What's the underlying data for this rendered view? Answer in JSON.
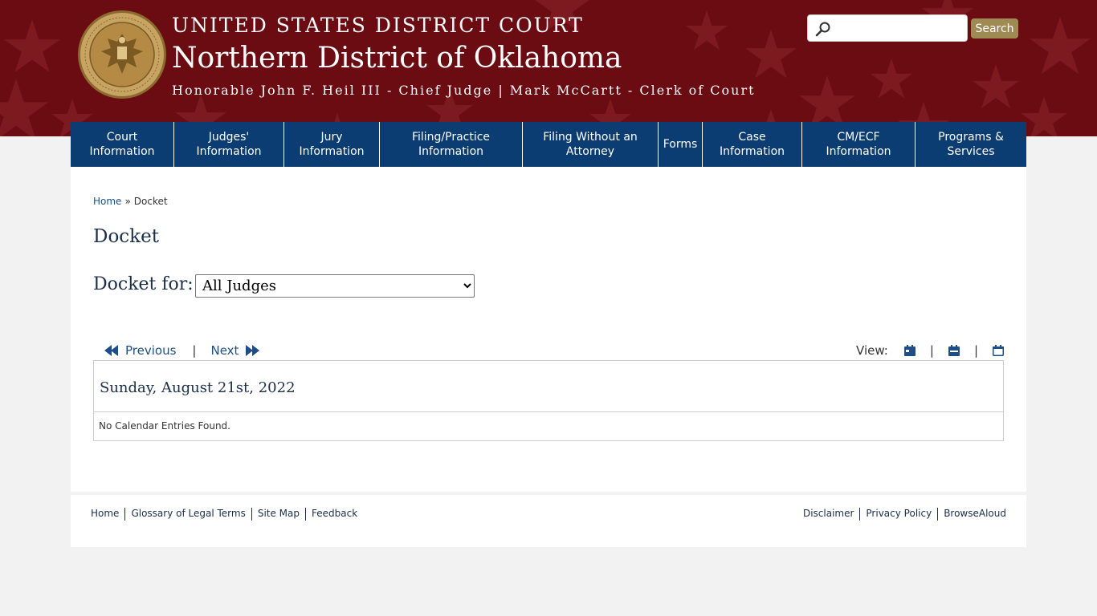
{
  "header": {
    "court_line": "UNITED STATES DISTRICT COURT",
    "district": "Northern District of Oklahoma",
    "officials": "Honorable John F. Heil III - Chief Judge | Mark McCartt - Clerk of Court",
    "seal_icon": "court-seal-icon",
    "search": {
      "placeholder": "",
      "button_label": "Search",
      "icon": "search-icon"
    },
    "colors": {
      "background": "#6b0b12",
      "search_button": "#a08a54"
    }
  },
  "nav": {
    "color": "#0b3d73",
    "items": [
      {
        "line1": "Court",
        "line2": "Information"
      },
      {
        "line1": "Judges'",
        "line2": "Information"
      },
      {
        "line1": "Jury",
        "line2": "Information"
      },
      {
        "line1": "Filing/Practice",
        "line2": "Information"
      },
      {
        "line1": "Filing Without an",
        "line2": "Attorney"
      },
      {
        "line1": "Forms",
        "line2": ""
      },
      {
        "line1": "Case",
        "line2": "Information"
      },
      {
        "line1": "CM/ECF",
        "line2": "Information"
      },
      {
        "line1": "Programs &",
        "line2": "Services"
      }
    ]
  },
  "breadcrumb": {
    "home": "Home",
    "separator": "»",
    "current": "Docket"
  },
  "page": {
    "title": "Docket",
    "docket_for_label": "Docket for:",
    "docket_select_value": "All Judges"
  },
  "pager": {
    "previous": "Previous",
    "next": "Next",
    "separator": "|",
    "view_label": "View:"
  },
  "calendar": {
    "date": "Sunday, August 21st, 2022",
    "empty_message": "No Calendar Entries Found."
  },
  "footer": {
    "left": [
      "Home",
      "Glossary of Legal Terms",
      "Site Map",
      "Feedback"
    ],
    "right": [
      "Disclaimer",
      "Privacy Policy",
      "BrowseAloud"
    ]
  }
}
